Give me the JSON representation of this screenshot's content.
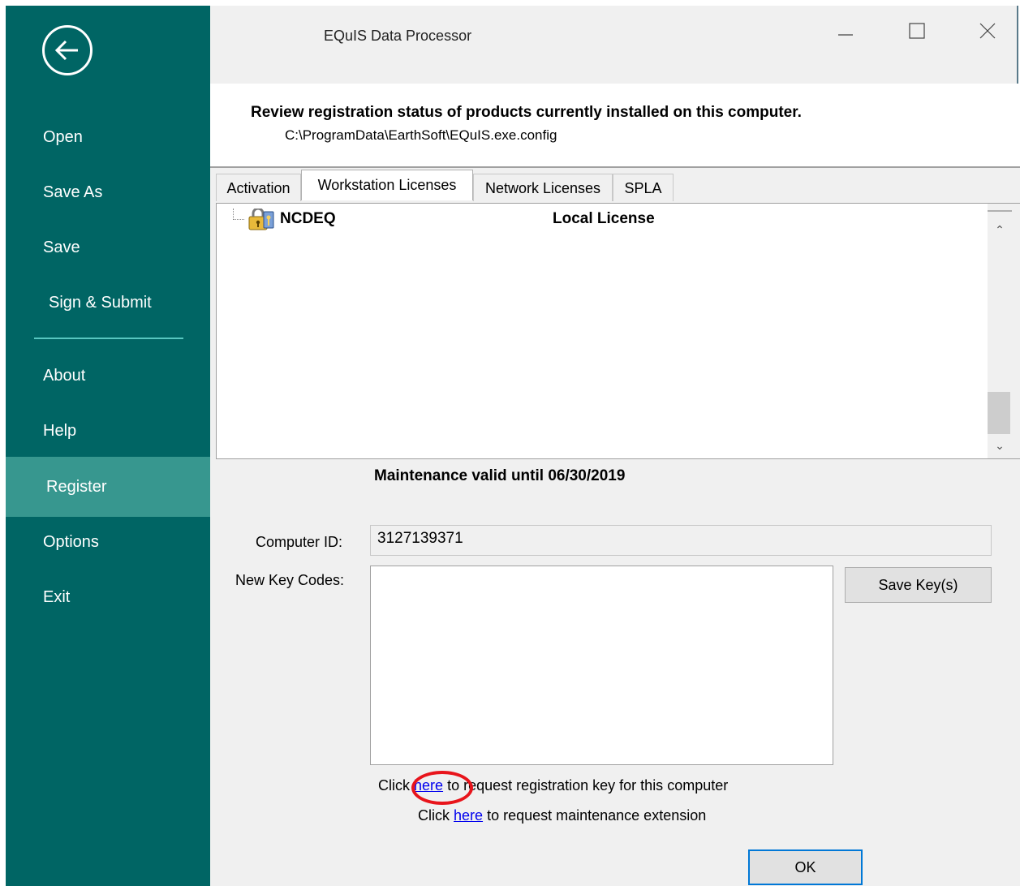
{
  "window": {
    "title": "EQuIS Data Processor"
  },
  "sidebar": {
    "items": [
      {
        "label": "Open"
      },
      {
        "label": "Save As"
      },
      {
        "label": "Save"
      },
      {
        "label": "Sign & Submit"
      },
      {
        "label": "About"
      },
      {
        "label": "Help"
      },
      {
        "label": "Register",
        "active": true
      },
      {
        "label": "Options"
      },
      {
        "label": "Exit"
      }
    ]
  },
  "header": {
    "title": "Review registration status of products currently installed on this computer.",
    "path": "C:\\ProgramData\\EarthSoft\\EQuIS.exe.config"
  },
  "tabs": [
    {
      "label": "Activation"
    },
    {
      "label": "Workstation Licenses",
      "active": true
    },
    {
      "label": "Network Licenses"
    },
    {
      "label": "SPLA"
    }
  ],
  "tree": {
    "items": [
      {
        "name": "NCDEQ",
        "license": "Local License",
        "icon": "lock-key-icon"
      }
    ]
  },
  "maintenance": "Maintenance valid until 06/30/2019",
  "form": {
    "computer_id_label": "Computer ID:",
    "computer_id_value": "3127139371",
    "key_codes_label": "New Key Codes:",
    "key_codes_value": "",
    "save_keys_label": "Save Key(s)"
  },
  "links": {
    "reg_prefix": "Click",
    "reg_link": "here",
    "reg_suffix": "to request registration key for this computer",
    "maint_prefix": "Click",
    "maint_link": "here",
    "maint_suffix": "to request maintenance extension"
  },
  "ok_label": "OK",
  "colors": {
    "sidebar": "#006564",
    "sidebar_active": "#37978f",
    "highlight": "#e8141b",
    "link": "#0000ee"
  }
}
